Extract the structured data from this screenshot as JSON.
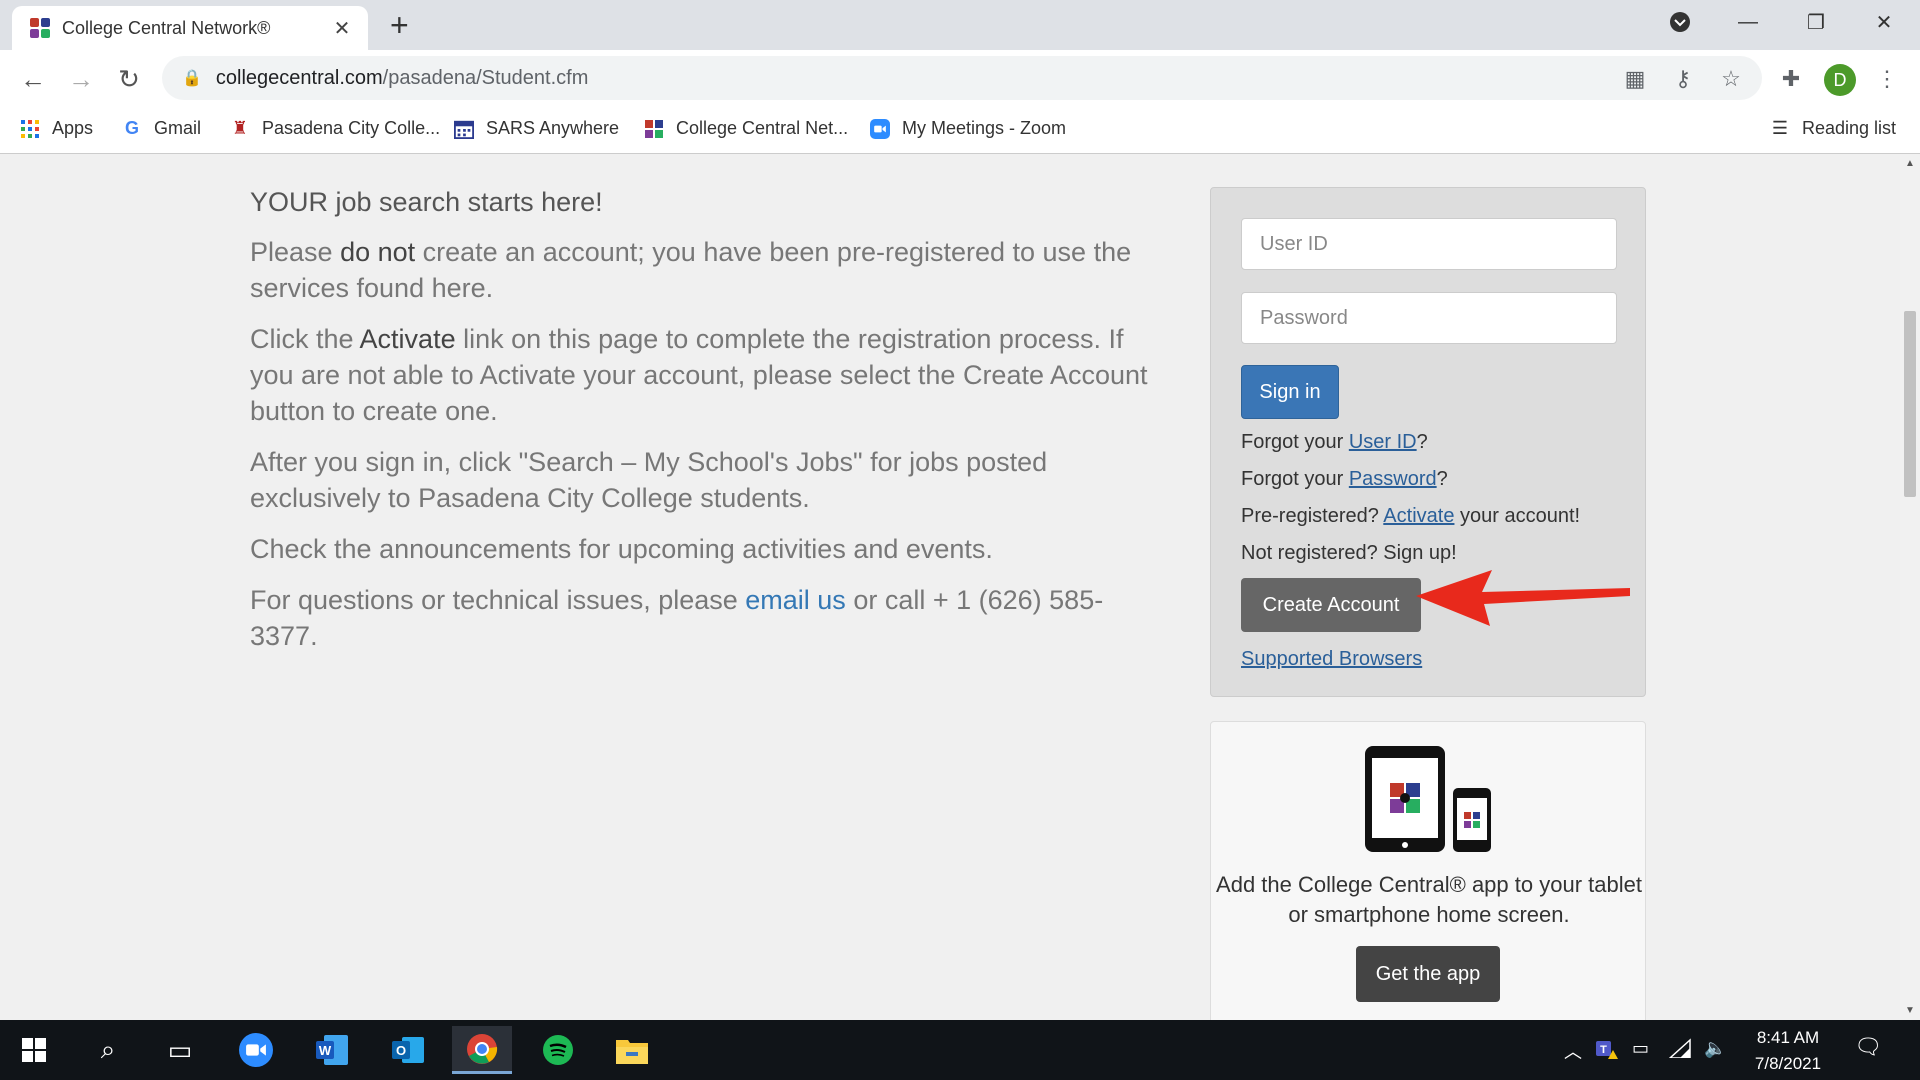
{
  "browser": {
    "tab_title": "College Central Network®",
    "new_tab": "+",
    "url_domain": "collegecentral.com",
    "url_path": "/pasadena/Student.cfm",
    "profile_initial": "D"
  },
  "bookmarks": [
    {
      "label": "Apps",
      "icon": "apps-grid-icon"
    },
    {
      "label": "Gmail",
      "icon": "google-icon"
    },
    {
      "label": "Pasadena City Colle...",
      "icon": "pcc-icon"
    },
    {
      "label": "SARS Anywhere",
      "icon": "calendar-icon"
    },
    {
      "label": "College Central Net...",
      "icon": "college-central-icon"
    },
    {
      "label": "My Meetings - Zoom",
      "icon": "zoom-icon"
    }
  ],
  "reading_list": "Reading list",
  "content": {
    "heading": "YOUR job search starts here!",
    "p1_a": "Please ",
    "p1_b": "do not",
    "p1_c": " create an account; you have been pre-registered to use the services found here.",
    "p2_a": "Click the ",
    "p2_b": "Activate",
    "p2_c": " link on this page to complete the registration process. If you are not able to Activate your account, please select the Create Account button to create one.",
    "p3": "After you sign in, click \"Search – My School's Jobs\" for jobs posted exclusively to Pasadena City College students.",
    "p4": "Check the announcements for upcoming activities and events.",
    "p5_a": "For questions or technical issues, please ",
    "p5_link": "email us",
    "p5_b": " or call + 1 (626) 585-3377."
  },
  "login": {
    "userid_placeholder": "User ID",
    "password_placeholder": "Password",
    "signin": "Sign in",
    "forgot_userid_a": "Forgot your ",
    "forgot_userid_link": "User ID",
    "forgot_userid_b": "?",
    "forgot_password_a": "Forgot your ",
    "forgot_password_link": "Password",
    "forgot_password_b": "?",
    "prereg_a": "Pre-registered? ",
    "prereg_link": "Activate",
    "prereg_b": " your account!",
    "not_registered": "Not registered? Sign up!",
    "create_account": "Create Account",
    "supported_browsers": "Supported Browsers"
  },
  "app_promo": {
    "text": "Add the College Central® app to your tablet or smartphone home screen.",
    "button": "Get the app"
  },
  "taskbar": {
    "time": "8:41 AM",
    "date": "7/8/2021"
  },
  "colors": {
    "signin_blue": "#3a76b6",
    "create_gray": "#666666",
    "arrow_red": "#e8291c",
    "link_blue": "#2a5f99"
  }
}
